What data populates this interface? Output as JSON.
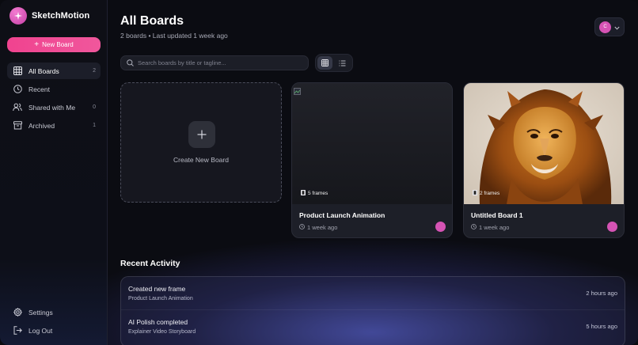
{
  "app": {
    "name": "SketchMotion"
  },
  "sidebar": {
    "new_board_label": "New Board",
    "items": [
      {
        "label": "All Boards",
        "count": "2",
        "icon": "grid-icon",
        "active": true
      },
      {
        "label": "Recent",
        "count": "",
        "icon": "clock-icon"
      },
      {
        "label": "Shared with Me",
        "count": "0",
        "icon": "users-icon"
      },
      {
        "label": "Archived",
        "count": "1",
        "icon": "archive-icon"
      }
    ],
    "bottom": [
      {
        "label": "Settings",
        "icon": "gear-icon"
      },
      {
        "label": "Log Out",
        "icon": "logout-icon"
      }
    ]
  },
  "header": {
    "title": "All Boards",
    "subtitle": "2 boards • Last updated 1 week ago",
    "avatar_initial": "C"
  },
  "search": {
    "placeholder": "Search boards by title or tagline..."
  },
  "view": {
    "mode": "grid"
  },
  "create_card": {
    "label": "Create New Board"
  },
  "boards": [
    {
      "title": "Product Launch Animation",
      "frames": "5 frames",
      "updated": "1 week ago"
    },
    {
      "title": "Untitled Board 1",
      "frames": "2 frames",
      "updated": "1 week ago"
    }
  ],
  "recent_activity": {
    "title": "Recent Activity",
    "items": [
      {
        "title": "Created new frame",
        "board": "Product Launch Animation",
        "time": "2 hours ago"
      },
      {
        "title": "AI Polish completed",
        "board": "Explainer Video Storyboard",
        "time": "5 hours ago"
      }
    ]
  },
  "colors": {
    "accent": "#f0438f",
    "avatar": "#d553b4",
    "background": "#0b0c12"
  }
}
